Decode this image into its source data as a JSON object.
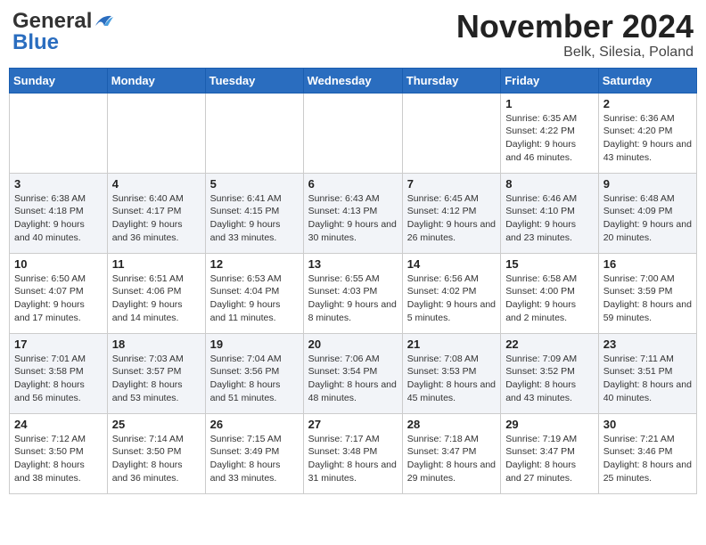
{
  "logo": {
    "general": "General",
    "blue": "Blue"
  },
  "header": {
    "month": "November 2024",
    "location": "Belk, Silesia, Poland"
  },
  "days_of_week": [
    "Sunday",
    "Monday",
    "Tuesday",
    "Wednesday",
    "Thursday",
    "Friday",
    "Saturday"
  ],
  "weeks": [
    [
      {
        "day": "",
        "info": ""
      },
      {
        "day": "",
        "info": ""
      },
      {
        "day": "",
        "info": ""
      },
      {
        "day": "",
        "info": ""
      },
      {
        "day": "",
        "info": ""
      },
      {
        "day": "1",
        "info": "Sunrise: 6:35 AM\nSunset: 4:22 PM\nDaylight: 9 hours and 46 minutes."
      },
      {
        "day": "2",
        "info": "Sunrise: 6:36 AM\nSunset: 4:20 PM\nDaylight: 9 hours and 43 minutes."
      }
    ],
    [
      {
        "day": "3",
        "info": "Sunrise: 6:38 AM\nSunset: 4:18 PM\nDaylight: 9 hours and 40 minutes."
      },
      {
        "day": "4",
        "info": "Sunrise: 6:40 AM\nSunset: 4:17 PM\nDaylight: 9 hours and 36 minutes."
      },
      {
        "day": "5",
        "info": "Sunrise: 6:41 AM\nSunset: 4:15 PM\nDaylight: 9 hours and 33 minutes."
      },
      {
        "day": "6",
        "info": "Sunrise: 6:43 AM\nSunset: 4:13 PM\nDaylight: 9 hours and 30 minutes."
      },
      {
        "day": "7",
        "info": "Sunrise: 6:45 AM\nSunset: 4:12 PM\nDaylight: 9 hours and 26 minutes."
      },
      {
        "day": "8",
        "info": "Sunrise: 6:46 AM\nSunset: 4:10 PM\nDaylight: 9 hours and 23 minutes."
      },
      {
        "day": "9",
        "info": "Sunrise: 6:48 AM\nSunset: 4:09 PM\nDaylight: 9 hours and 20 minutes."
      }
    ],
    [
      {
        "day": "10",
        "info": "Sunrise: 6:50 AM\nSunset: 4:07 PM\nDaylight: 9 hours and 17 minutes."
      },
      {
        "day": "11",
        "info": "Sunrise: 6:51 AM\nSunset: 4:06 PM\nDaylight: 9 hours and 14 minutes."
      },
      {
        "day": "12",
        "info": "Sunrise: 6:53 AM\nSunset: 4:04 PM\nDaylight: 9 hours and 11 minutes."
      },
      {
        "day": "13",
        "info": "Sunrise: 6:55 AM\nSunset: 4:03 PM\nDaylight: 9 hours and 8 minutes."
      },
      {
        "day": "14",
        "info": "Sunrise: 6:56 AM\nSunset: 4:02 PM\nDaylight: 9 hours and 5 minutes."
      },
      {
        "day": "15",
        "info": "Sunrise: 6:58 AM\nSunset: 4:00 PM\nDaylight: 9 hours and 2 minutes."
      },
      {
        "day": "16",
        "info": "Sunrise: 7:00 AM\nSunset: 3:59 PM\nDaylight: 8 hours and 59 minutes."
      }
    ],
    [
      {
        "day": "17",
        "info": "Sunrise: 7:01 AM\nSunset: 3:58 PM\nDaylight: 8 hours and 56 minutes."
      },
      {
        "day": "18",
        "info": "Sunrise: 7:03 AM\nSunset: 3:57 PM\nDaylight: 8 hours and 53 minutes."
      },
      {
        "day": "19",
        "info": "Sunrise: 7:04 AM\nSunset: 3:56 PM\nDaylight: 8 hours and 51 minutes."
      },
      {
        "day": "20",
        "info": "Sunrise: 7:06 AM\nSunset: 3:54 PM\nDaylight: 8 hours and 48 minutes."
      },
      {
        "day": "21",
        "info": "Sunrise: 7:08 AM\nSunset: 3:53 PM\nDaylight: 8 hours and 45 minutes."
      },
      {
        "day": "22",
        "info": "Sunrise: 7:09 AM\nSunset: 3:52 PM\nDaylight: 8 hours and 43 minutes."
      },
      {
        "day": "23",
        "info": "Sunrise: 7:11 AM\nSunset: 3:51 PM\nDaylight: 8 hours and 40 minutes."
      }
    ],
    [
      {
        "day": "24",
        "info": "Sunrise: 7:12 AM\nSunset: 3:50 PM\nDaylight: 8 hours and 38 minutes."
      },
      {
        "day": "25",
        "info": "Sunrise: 7:14 AM\nSunset: 3:50 PM\nDaylight: 8 hours and 36 minutes."
      },
      {
        "day": "26",
        "info": "Sunrise: 7:15 AM\nSunset: 3:49 PM\nDaylight: 8 hours and 33 minutes."
      },
      {
        "day": "27",
        "info": "Sunrise: 7:17 AM\nSunset: 3:48 PM\nDaylight: 8 hours and 31 minutes."
      },
      {
        "day": "28",
        "info": "Sunrise: 7:18 AM\nSunset: 3:47 PM\nDaylight: 8 hours and 29 minutes."
      },
      {
        "day": "29",
        "info": "Sunrise: 7:19 AM\nSunset: 3:47 PM\nDaylight: 8 hours and 27 minutes."
      },
      {
        "day": "30",
        "info": "Sunrise: 7:21 AM\nSunset: 3:46 PM\nDaylight: 8 hours and 25 minutes."
      }
    ]
  ]
}
